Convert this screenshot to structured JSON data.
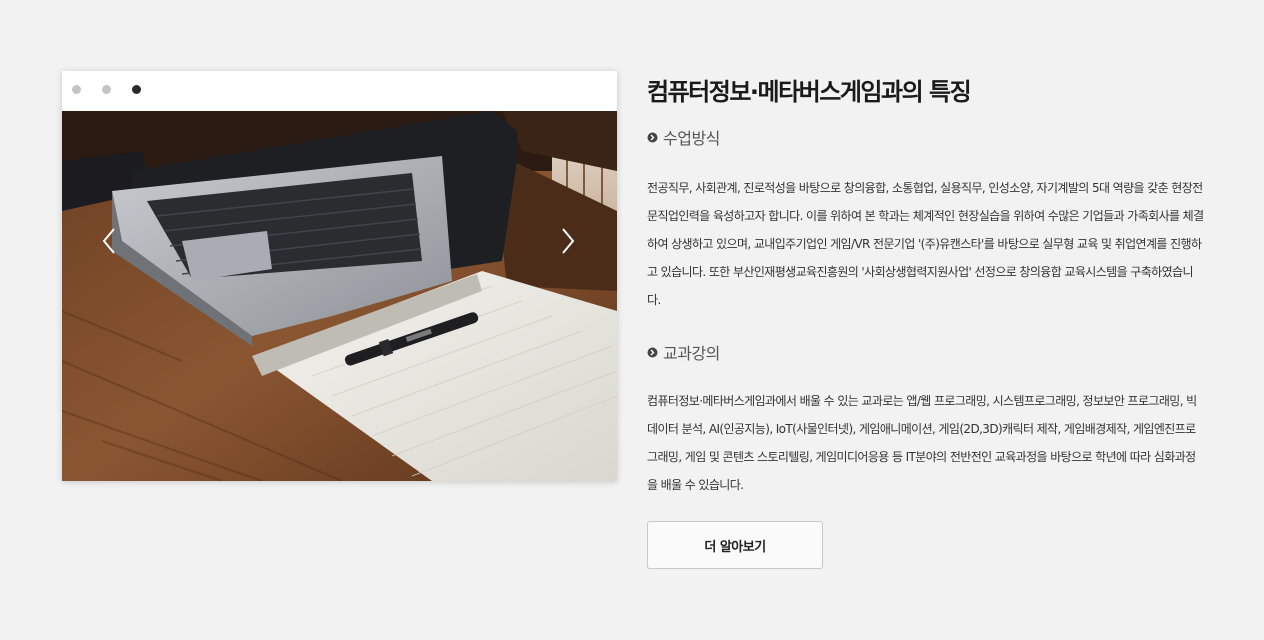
{
  "slider": {
    "active_index": 3,
    "dot_count": 3,
    "prev_icon": "chevron-left-icon",
    "next_icon": "chevron-right-icon",
    "image": "laptop-and-notebook-on-wooden-desk"
  },
  "content": {
    "title": "컴퓨터정보·메타버스게임과의 특징",
    "sections": [
      {
        "icon": "circle-arrow-right-icon",
        "heading": "수업방식",
        "text": "전공직무, 사회관계, 진로적성을 바탕으로 창의융합, 소통협업, 실용직무, 인성소양, 자기계발의 5대 역량을 갖춘 현장전문직업인력을 육성하고자 합니다. 이를 위하여 본 학과는 체계적인 현장실습을 위하여 수많은 기업들과 가족회사를 체결하여 상생하고 있으며, 교내입주기업인 게임/VR 전문기업 '(주)유캔스타'를 바탕으로 실무형 교육 및 취업연계를 진행하고 있습니다. 또한 부산인재평생교육진흥원의 '사회상생협력지원사업' 선정으로 창의융합 교육시스템을 구축하였습니다."
      },
      {
        "icon": "circle-arrow-right-icon",
        "heading": "교과강의",
        "text": "컴퓨터정보·메타버스게임과에서 배울 수 있는 교과로는 앱/웹 프로그래밍, 시스템프로그래밍, 정보보안 프로그래밍, 빅데이터 분석, AI(인공지능), IoT(사물인터넷), 게임애니메이션, 게임(2D,3D)캐릭터 제작, 게임배경제작, 게임엔진프로그래밍, 게임 및 콘텐츠 스토리텔링, 게임미디어응용 등 IT분야의 전반전인 교육과정을 바탕으로 학년에 따라 심화과정을 배울 수 있습니다."
      }
    ],
    "more_button_label": "더 알아보기"
  },
  "colors": {
    "background": "#f2f2f2",
    "dot_active": "#2a2a2a",
    "dot_inactive": "#c4c4c4",
    "title": "#1a1a1a",
    "body_text": "#333333"
  }
}
